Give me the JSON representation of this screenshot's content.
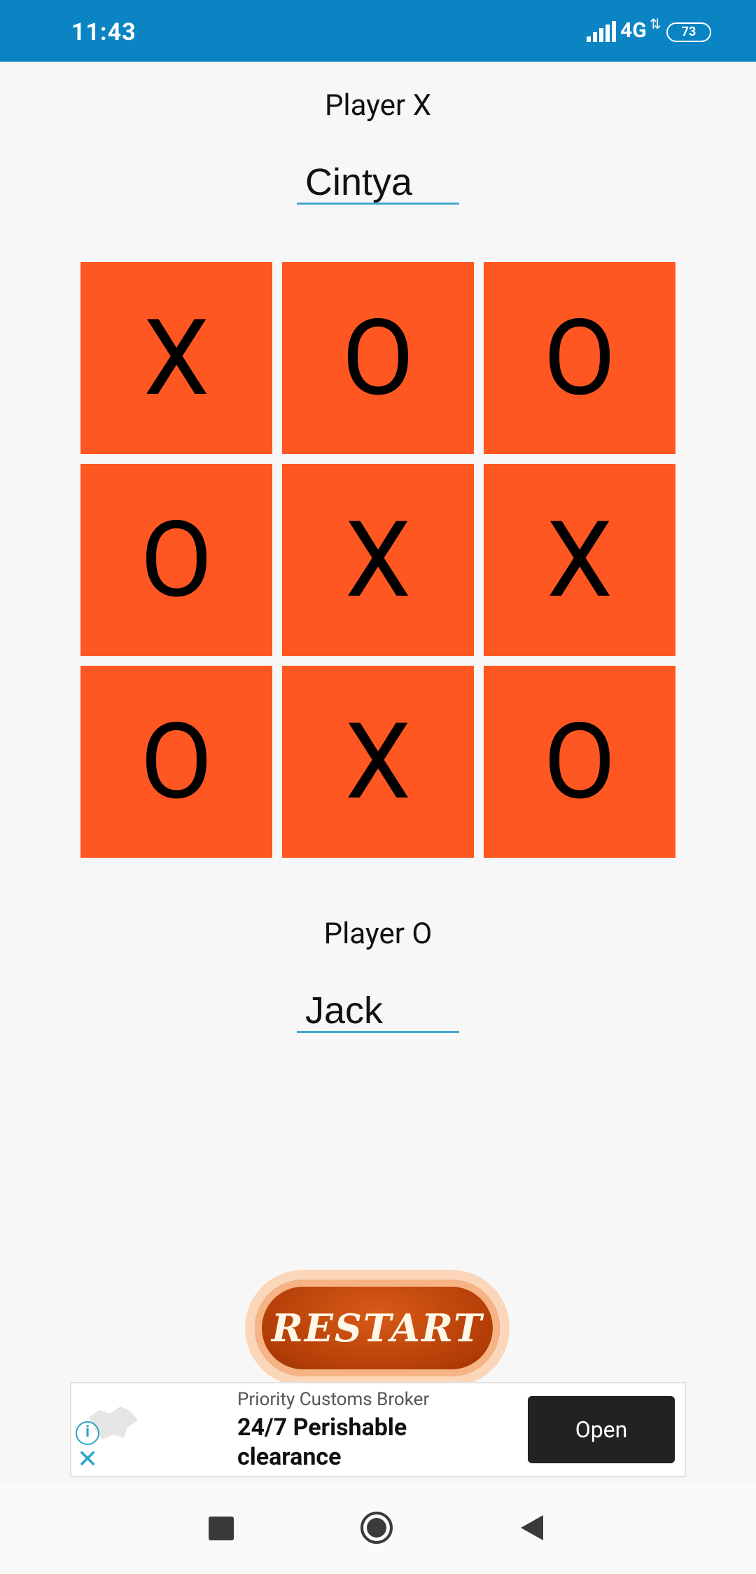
{
  "status_bar": {
    "time": "11:43",
    "network": "4G",
    "battery": "73"
  },
  "player_x": {
    "label": "Player X",
    "name": "Cintya"
  },
  "board": {
    "cells": [
      "X",
      "O",
      "O",
      "O",
      "X",
      "X",
      "O",
      "X",
      "O"
    ]
  },
  "player_o": {
    "label": "Player O",
    "name": "Jack"
  },
  "restart": {
    "label": "RESTART"
  },
  "ad": {
    "sponsor": "Priority Customs Broker",
    "headline": "24/7 Perishable clearance",
    "cta": "Open"
  },
  "colors": {
    "status_bar": "#0a84c2",
    "cell": "#ff5722",
    "underline": "#45a6c9"
  }
}
